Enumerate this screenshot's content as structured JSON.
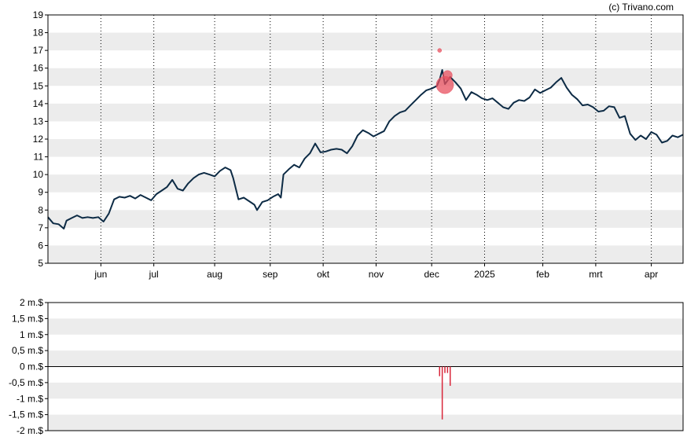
{
  "copyright": "(c) Trivano.com",
  "colors": {
    "price_line": "#0d2b45",
    "band": "#ececec",
    "volume_bar": "#d9263a",
    "marker": "#e8505f"
  },
  "chart_data": [
    {
      "type": "line",
      "ylim": [
        5,
        19
      ],
      "yticks": [
        "5",
        "6",
        "7",
        "8",
        "9",
        "10",
        "11",
        "12",
        "13",
        "14",
        "15",
        "16",
        "17",
        "18",
        "19"
      ],
      "months": [
        "jun",
        "jul",
        "aug",
        "sep",
        "okt",
        "nov",
        "dec",
        "2025",
        "feb",
        "mrt",
        "apr"
      ],
      "month_positions": [
        18,
        48,
        81,
        112,
        140,
        167,
        195,
        226,
        258,
        286,
        317
      ],
      "total_days": 365,
      "grid": true,
      "series": [
        {
          "points": [
            [
              0,
              7.6
            ],
            [
              2,
              7.25
            ],
            [
              4,
              7.2
            ],
            [
              6,
              6.95
            ],
            [
              7,
              7.4
            ],
            [
              9,
              7.55
            ],
            [
              11,
              7.7
            ],
            [
              13,
              7.55
            ],
            [
              15,
              7.6
            ],
            [
              17,
              7.55
            ],
            [
              19,
              7.6
            ],
            [
              21,
              7.35
            ],
            [
              23,
              7.8
            ],
            [
              25,
              8.6
            ],
            [
              27,
              8.75
            ],
            [
              29,
              8.7
            ],
            [
              31,
              8.8
            ],
            [
              33,
              8.65
            ],
            [
              35,
              8.85
            ],
            [
              37,
              8.7
            ],
            [
              39,
              8.55
            ],
            [
              41,
              8.9
            ],
            [
              43,
              9.1
            ],
            [
              45,
              9.3
            ],
            [
              47,
              9.7
            ],
            [
              49,
              9.2
            ],
            [
              51,
              9.1
            ],
            [
              53,
              9.5
            ],
            [
              55,
              9.8
            ],
            [
              57,
              10.0
            ],
            [
              59,
              10.1
            ],
            [
              61,
              10.0
            ],
            [
              63,
              9.9
            ],
            [
              65,
              10.2
            ],
            [
              67,
              10.4
            ],
            [
              69,
              10.25
            ],
            [
              70,
              9.8
            ],
            [
              72,
              8.6
            ],
            [
              74,
              8.7
            ],
            [
              76,
              8.5
            ],
            [
              78,
              8.3
            ],
            [
              79,
              8.0
            ],
            [
              81,
              8.45
            ],
            [
              83,
              8.55
            ],
            [
              85,
              8.75
            ],
            [
              87,
              8.9
            ],
            [
              88,
              8.7
            ],
            [
              89,
              10.0
            ],
            [
              91,
              10.3
            ],
            [
              93,
              10.55
            ],
            [
              95,
              10.4
            ],
            [
              97,
              10.9
            ],
            [
              99,
              11.2
            ],
            [
              101,
              11.75
            ],
            [
              103,
              11.25
            ],
            [
              105,
              11.3
            ],
            [
              107,
              11.4
            ],
            [
              109,
              11.45
            ],
            [
              111,
              11.4
            ],
            [
              113,
              11.2
            ],
            [
              115,
              11.6
            ],
            [
              117,
              12.2
            ],
            [
              119,
              12.5
            ],
            [
              121,
              12.35
            ],
            [
              123,
              12.15
            ],
            [
              125,
              12.3
            ],
            [
              127,
              12.45
            ],
            [
              129,
              13.0
            ],
            [
              131,
              13.3
            ],
            [
              133,
              13.5
            ],
            [
              135,
              13.6
            ],
            [
              137,
              13.9
            ],
            [
              139,
              14.2
            ],
            [
              141,
              14.5
            ],
            [
              143,
              14.75
            ],
            [
              145,
              14.85
            ],
            [
              147,
              15.0
            ],
            [
              148,
              15.35
            ],
            [
              149,
              15.9
            ],
            [
              150,
              15.1
            ],
            [
              152,
              15.5
            ],
            [
              154,
              15.2
            ],
            [
              156,
              14.85
            ],
            [
              158,
              14.2
            ],
            [
              160,
              14.65
            ],
            [
              162,
              14.5
            ],
            [
              164,
              14.3
            ],
            [
              166,
              14.2
            ],
            [
              168,
              14.3
            ],
            [
              170,
              14.05
            ],
            [
              172,
              13.8
            ],
            [
              174,
              13.7
            ],
            [
              176,
              14.05
            ],
            [
              178,
              14.2
            ],
            [
              180,
              14.15
            ],
            [
              182,
              14.35
            ],
            [
              184,
              14.8
            ],
            [
              186,
              14.6
            ],
            [
              188,
              14.75
            ],
            [
              190,
              14.9
            ],
            [
              192,
              15.2
            ],
            [
              194,
              15.45
            ],
            [
              196,
              14.9
            ],
            [
              198,
              14.5
            ],
            [
              200,
              14.25
            ],
            [
              202,
              13.9
            ],
            [
              204,
              13.95
            ],
            [
              206,
              13.8
            ],
            [
              208,
              13.55
            ],
            [
              210,
              13.6
            ],
            [
              212,
              13.85
            ],
            [
              214,
              13.8
            ],
            [
              216,
              13.2
            ],
            [
              218,
              13.3
            ],
            [
              220,
              12.3
            ],
            [
              222,
              11.95
            ],
            [
              224,
              12.2
            ],
            [
              226,
              12.0
            ],
            [
              228,
              12.4
            ],
            [
              230,
              12.25
            ],
            [
              232,
              11.8
            ],
            [
              234,
              11.9
            ],
            [
              236,
              12.2
            ],
            [
              238,
              12.1
            ],
            [
              240,
              12.25
            ]
          ]
        }
      ],
      "markers": [
        {
          "x": 150,
          "y": 15.05,
          "size": "large"
        },
        {
          "x": 151,
          "y": 15.6,
          "size": "medium"
        },
        {
          "x": 148,
          "y": 17.0,
          "size": "small"
        }
      ]
    },
    {
      "type": "bar",
      "ylim": [
        -2,
        2
      ],
      "yticks": [
        "-2 m.$",
        "-1,5 m.$",
        "-1 m.$",
        "-0,5 m.$",
        "0 m.$",
        "0,5 m.$",
        "1 m.$",
        "1,5 m.$",
        "2 m.$"
      ],
      "grid": true,
      "bars": [
        {
          "x": 148,
          "value": -0.3
        },
        {
          "x": 149,
          "value": -1.65
        },
        {
          "x": 150,
          "value": -0.2
        },
        {
          "x": 151,
          "value": -0.2
        },
        {
          "x": 152,
          "value": -0.6
        }
      ]
    }
  ]
}
